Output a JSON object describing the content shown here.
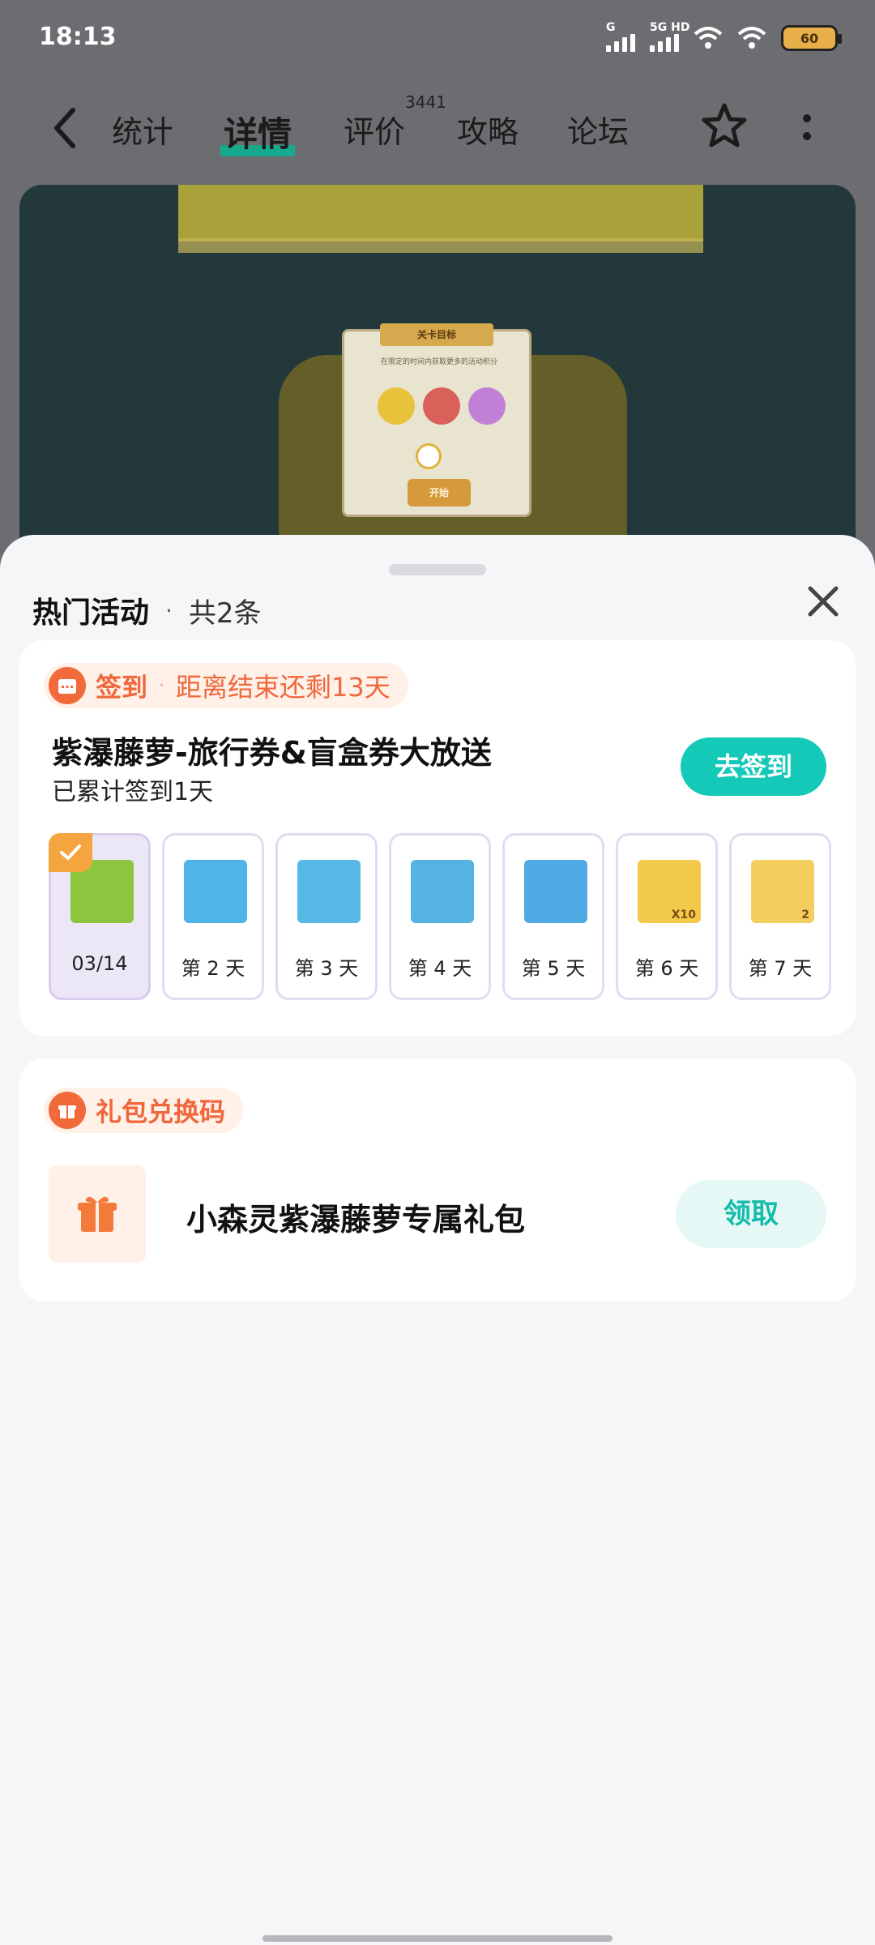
{
  "status_bar": {
    "time": "18:13",
    "signal_tag_1": "G",
    "signal_tag_2": "5G HD",
    "battery": "60"
  },
  "nav": {
    "tabs": [
      {
        "label": "统计"
      },
      {
        "label": "详情"
      },
      {
        "label": "评价"
      },
      {
        "label": "攻略"
      },
      {
        "label": "论坛"
      }
    ],
    "active_tab": "详情",
    "review_count": "3441"
  },
  "banner": {
    "dialog_title": "关卡目标",
    "dialog_hint": "在限定的时间内获取更多的活动积分",
    "start_label": "开始"
  },
  "sheet": {
    "title": "热门活动",
    "count_label": "共2条",
    "signin_card": {
      "tag": "签到",
      "remaining": "距离结束还剩13天",
      "title": "紫瀑藤萝-旅行券&盲盒券大放送",
      "progress": "已累计签到1天",
      "button": "去签到",
      "days": [
        {
          "label": "03/14",
          "done": true,
          "color": "#8cc63f"
        },
        {
          "label": "第 2 天",
          "done": false,
          "color": "#4fb4e8"
        },
        {
          "label": "第 3 天",
          "done": false,
          "color": "#58b8e6"
        },
        {
          "label": "第 4 天",
          "done": false,
          "color": "#55b3e4"
        },
        {
          "label": "第 5 天",
          "done": false,
          "color": "#4fa9e2"
        },
        {
          "label": "第 6 天",
          "done": false,
          "color": "#f3c94c",
          "badge": "X10"
        },
        {
          "label": "第 7 天",
          "done": false,
          "color": "#f2cf5e",
          "badge": "2"
        }
      ]
    },
    "gift_card": {
      "tag": "礼包兑换码",
      "name": "小森灵紫瀑藤萝专属礼包",
      "button": "领取"
    }
  },
  "colors": {
    "accent_teal": "#14c9b7",
    "accent_orange": "#f0673b",
    "nav_underline": "#17a98e"
  }
}
